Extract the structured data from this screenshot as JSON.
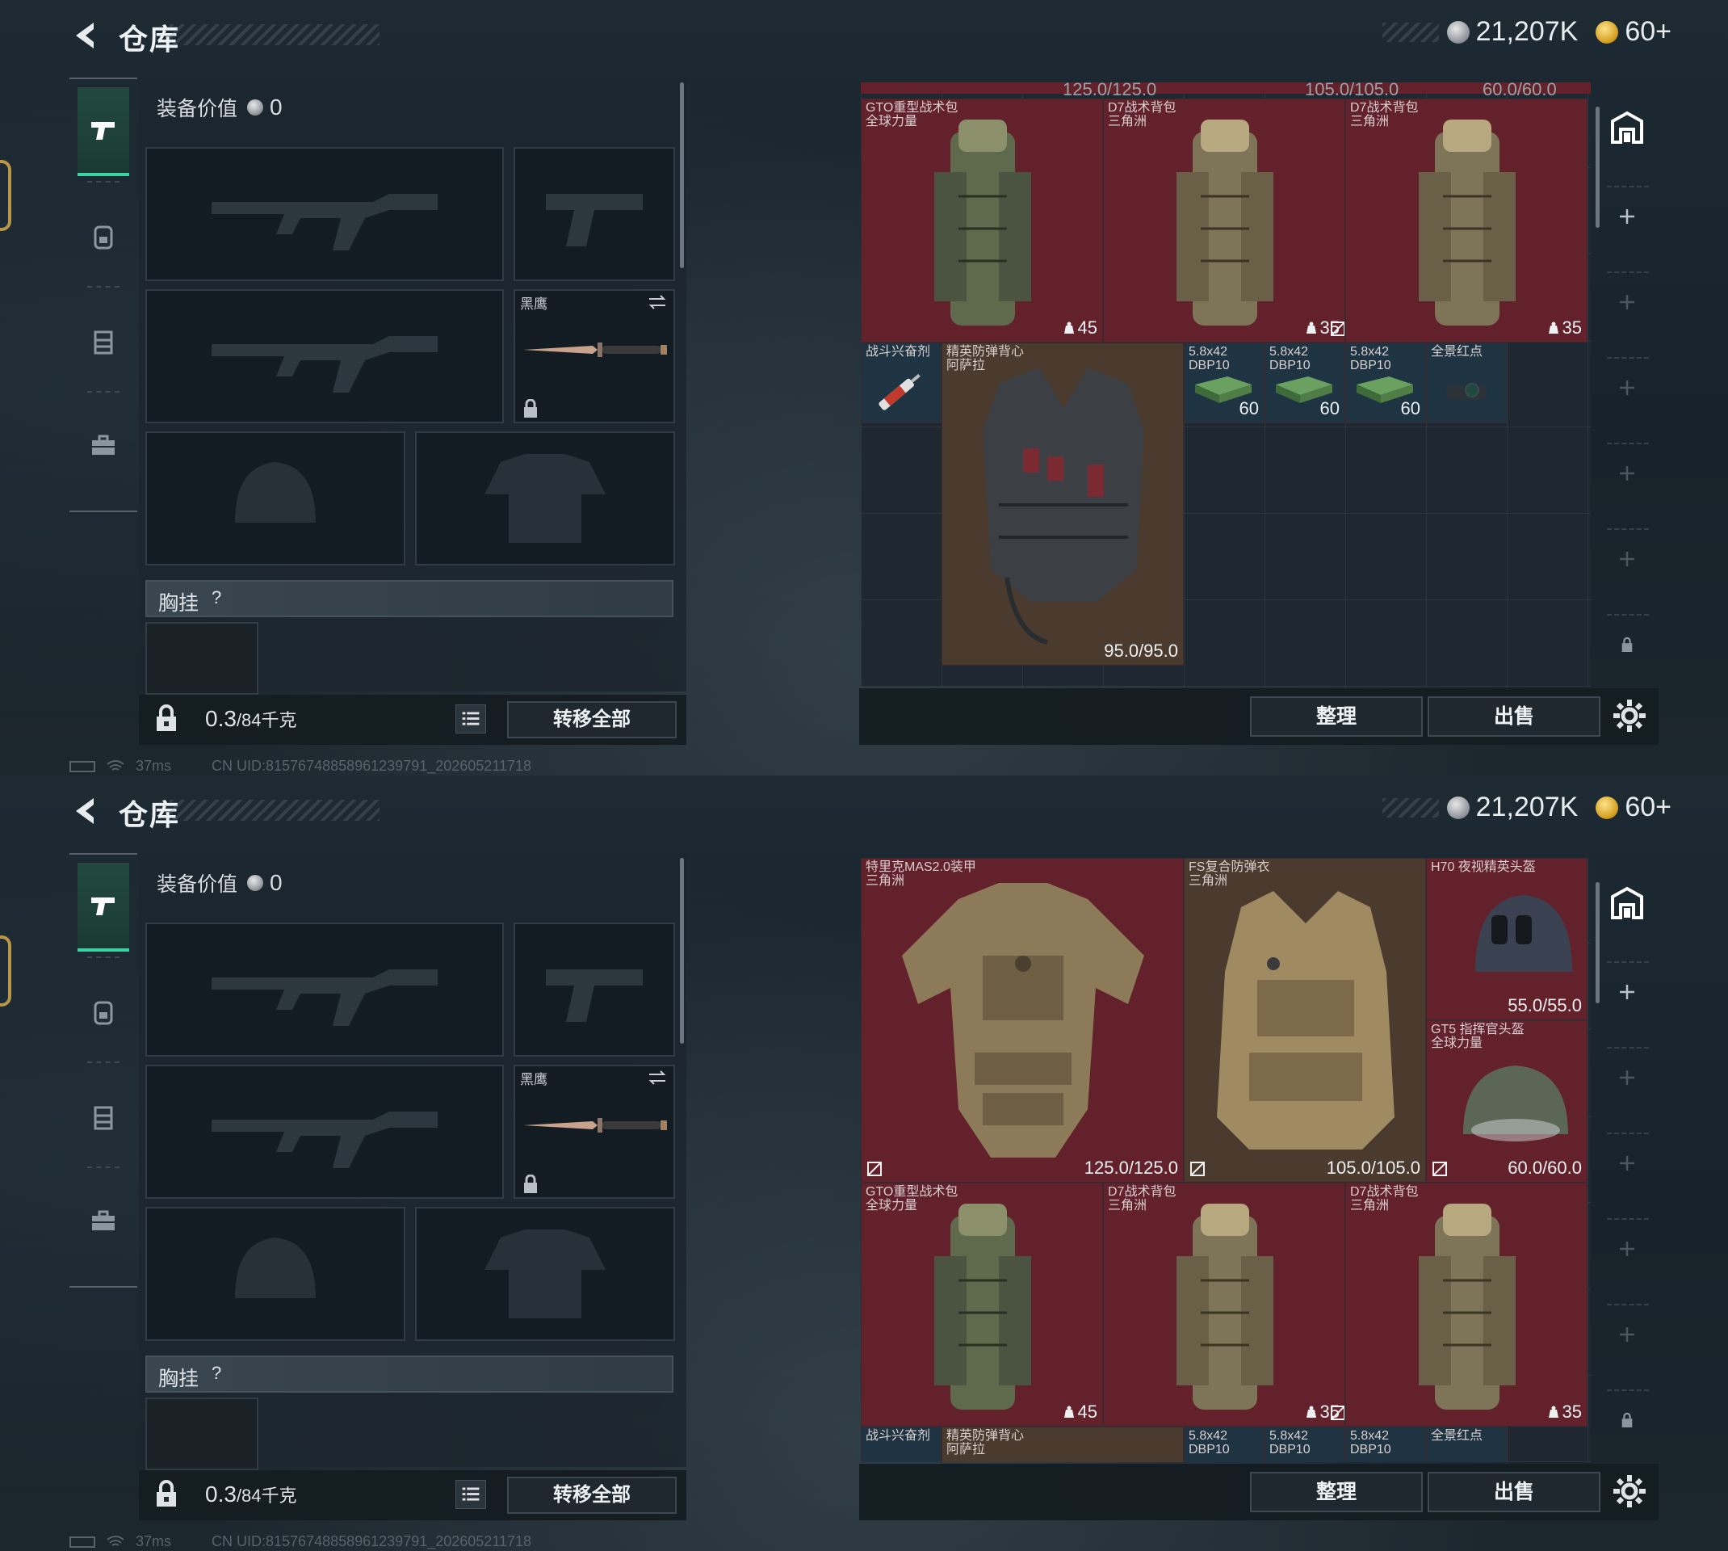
{
  "header": {
    "title": "仓库",
    "silver_amount": "21,207K",
    "gold_amount": "60+"
  },
  "equipment": {
    "value_label": "装备价值",
    "value_amount": "0",
    "melee_name": "黑鹰",
    "chest_rig_label": "胸挂",
    "chest_rig_help": "?",
    "weight_current": "0.3",
    "weight_max": "/84千克",
    "transfer_all": "转移全部"
  },
  "status_bar": {
    "ping": "37ms",
    "uid": "CN UID:81576748858961239791_202605211718"
  },
  "stash_actions": {
    "sort": "整理",
    "sell": "出售"
  },
  "screen1": {
    "top_row_durability": [
      "125.0/125.0",
      "105.0/105.0",
      "60.0/60.0"
    ],
    "backpacks": [
      {
        "name": "GTO重型战术包",
        "faction": "全球力量",
        "weight": "45"
      },
      {
        "name": "D7战术背包",
        "faction": "三角洲",
        "weight": "35"
      },
      {
        "name": "D7战术背包",
        "faction": "三角洲",
        "weight": "35"
      }
    ],
    "stimulant": {
      "name": "战斗兴奋剂"
    },
    "vest": {
      "name": "精英防弹背心",
      "faction": "阿萨拉",
      "durability": "95.0/95.0"
    },
    "ammo": [
      {
        "name": "5.8x42",
        "sub": "DBP10",
        "count": "60"
      },
      {
        "name": "5.8x42",
        "sub": "DBP10",
        "count": "60"
      },
      {
        "name": "5.8x42",
        "sub": "DBP10",
        "count": "60"
      }
    ],
    "sight": {
      "name": "全景红点"
    }
  },
  "screen2": {
    "armors": [
      {
        "name": "特里克MAS2.0装甲",
        "faction": "三角洲",
        "durability": "125.0/125.0"
      },
      {
        "name": "FS复合防弹衣",
        "faction": "三角洲",
        "durability": "105.0/105.0"
      }
    ],
    "helmets": [
      {
        "name": "H70 夜视精英头盔",
        "durability": "55.0/55.0"
      },
      {
        "name": "GT5 指挥官头盔",
        "faction": "全球力量",
        "durability": "60.0/60.0"
      }
    ],
    "backpacks": [
      {
        "name": "GTO重型战术包",
        "faction": "全球力量",
        "weight": "45"
      },
      {
        "name": "D7战术背包",
        "faction": "三角洲",
        "weight": "35"
      },
      {
        "name": "D7战术背包",
        "faction": "三角洲",
        "weight": "35"
      }
    ],
    "bottom_row": [
      "战斗兴奋剂",
      "精英防弹背心",
      "阿萨拉",
      "5.8x42",
      "5.8x42",
      "5.8x42",
      "DBP10",
      "DBP10",
      "DBP10",
      "全景红点"
    ]
  },
  "colors": {
    "item_red": "#62212b",
    "item_brown": "#4b3a2e",
    "item_blue": "#1f3442",
    "accent_green": "#3ed3a4"
  }
}
